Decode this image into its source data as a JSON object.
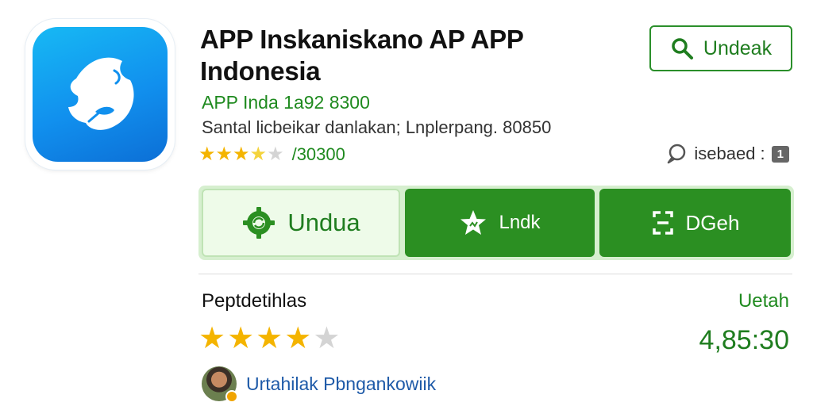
{
  "app": {
    "title": "APP Inskaniskano AP APP Indonesia",
    "developer": "APP Inda 1a92 8300",
    "meta": "Santal licbeikar danlakan; Lnplerpang. 80850",
    "rating_count": "/30300",
    "rating_stars": 3.5
  },
  "top_button": {
    "label": "Undeak",
    "icon": "search-icon"
  },
  "status": {
    "label": "isebaed :",
    "badge": "1",
    "icon": "chat-bubble-icon"
  },
  "actions": [
    {
      "label": "Undua",
      "icon": "gear-sync-icon"
    },
    {
      "label": "Lndk",
      "icon": "star-badge-icon"
    },
    {
      "label": "DGeh",
      "icon": "scan-icon"
    }
  ],
  "ratings_section": {
    "title": "Peptdetihlas",
    "link": "Uetah",
    "stars": 4,
    "score": "4,85:30"
  },
  "reviewer": {
    "name": "Urtahilak Pbnganko​wiik"
  },
  "colors": {
    "brand_green": "#2b8f22",
    "accent_blue": "#1190ee",
    "star": "#f4b400"
  }
}
